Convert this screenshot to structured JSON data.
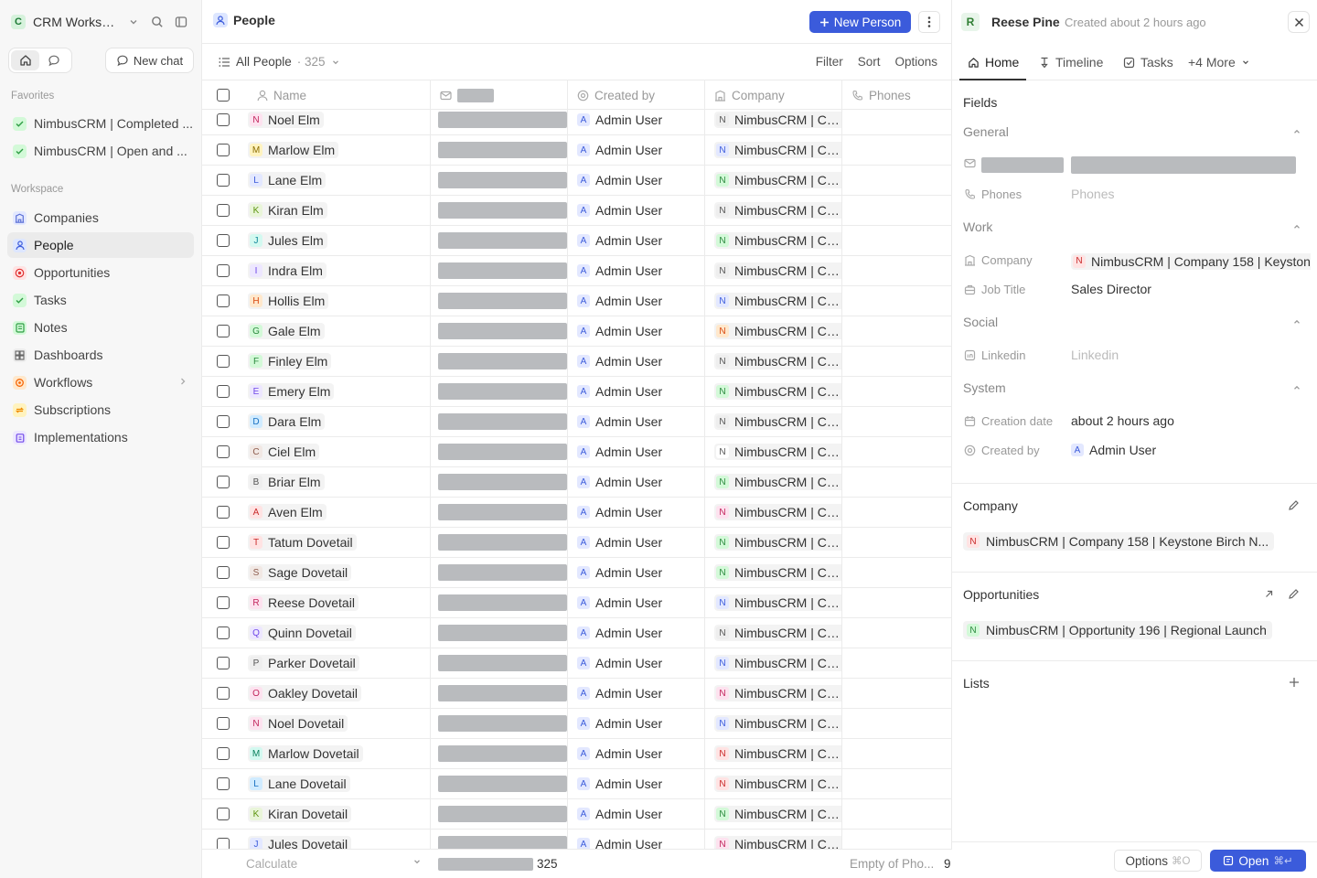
{
  "workspace": {
    "name": "CRM Workspace",
    "logo_letter": "C"
  },
  "sidebar": {
    "new_chat_label": "New chat",
    "favorites_label": "Favorites",
    "favorites": [
      {
        "label": "NimbusCRM | Completed ..."
      },
      {
        "label": "NimbusCRM | Open and ..."
      }
    ],
    "workspace_label": "Workspace",
    "items": [
      {
        "label": "Companies",
        "icon": "building-icon",
        "color": "#5a6fd6",
        "bg": "#e3e8ff"
      },
      {
        "label": "People",
        "icon": "user-icon",
        "color": "#3b5bdb",
        "bg": "#dde6ff"
      },
      {
        "label": "Opportunities",
        "icon": "target-icon",
        "color": "#e03131",
        "bg": "#ffe3e3"
      },
      {
        "label": "Tasks",
        "icon": "checkbox-icon",
        "color": "#2f9e44",
        "bg": "#d3f9d8"
      },
      {
        "label": "Notes",
        "icon": "note-icon",
        "color": "#2f9e44",
        "bg": "#d3f9d8"
      },
      {
        "label": "Dashboards",
        "icon": "dashboard-icon",
        "color": "#666666",
        "bg": "#ececec"
      },
      {
        "label": "Workflows",
        "icon": "workflow-icon",
        "color": "#f76707",
        "bg": "#ffe8cc"
      },
      {
        "label": "Subscriptions",
        "icon": "repeat-icon",
        "color": "#f08c00",
        "bg": "#fff3bf"
      },
      {
        "label": "Implementations",
        "icon": "clipboard-icon",
        "color": "#7048e8",
        "bg": "#ede7ff"
      }
    ]
  },
  "header": {
    "title": "People",
    "new_button": "New Person"
  },
  "view": {
    "name": "All People",
    "count": "· 325",
    "actions": [
      "Filter",
      "Sort",
      "Options"
    ]
  },
  "table": {
    "columns": {
      "name": "Name",
      "created_by": "Created by",
      "company": "Company",
      "phones": "Phones"
    },
    "rows": [
      {
        "letter": "N",
        "name": "Noel Elm",
        "created_by": "Admin User",
        "company": "NimbusCRM | Co...",
        "av": "#fde2ef",
        "avc": "#c2255c",
        "cc": "#eee",
        "ct": "#555"
      },
      {
        "letter": "M",
        "name": "Marlow Elm",
        "created_by": "Admin User",
        "company": "NimbusCRM | Co...",
        "av": "#fff3bf",
        "avc": "#8a6d00",
        "cc": "#e3e8ff",
        "ct": "#3b5bdb"
      },
      {
        "letter": "L",
        "name": "Lane Elm",
        "created_by": "Admin User",
        "company": "NimbusCRM | Co...",
        "av": "#e3e8ff",
        "avc": "#3b5bdb",
        "cc": "#d3f9d8",
        "ct": "#2b8a3e"
      },
      {
        "letter": "K",
        "name": "Kiran Elm",
        "created_by": "Admin User",
        "company": "NimbusCRM | Co...",
        "av": "#e9f5d9",
        "avc": "#5c940d",
        "cc": "#eee",
        "ct": "#555"
      },
      {
        "letter": "J",
        "name": "Jules Elm",
        "created_by": "Admin User",
        "company": "NimbusCRM | Co...",
        "av": "#d3f9f0",
        "avc": "#0c8599",
        "cc": "#d3f9d8",
        "ct": "#2b8a3e"
      },
      {
        "letter": "I",
        "name": "Indra Elm",
        "created_by": "Admin User",
        "company": "NimbusCRM | Co...",
        "av": "#ede7ff",
        "avc": "#7048e8",
        "cc": "#eee",
        "ct": "#555"
      },
      {
        "letter": "H",
        "name": "Hollis Elm",
        "created_by": "Admin User",
        "company": "NimbusCRM | Co...",
        "av": "#ffe8cc",
        "avc": "#d9480f",
        "cc": "#e3e8ff",
        "ct": "#3b5bdb"
      },
      {
        "letter": "G",
        "name": "Gale Elm",
        "created_by": "Admin User",
        "company": "NimbusCRM | Co...",
        "av": "#d3f9d8",
        "avc": "#2b8a3e",
        "cc": "#ffe8cc",
        "ct": "#d9480f"
      },
      {
        "letter": "F",
        "name": "Finley Elm",
        "created_by": "Admin User",
        "company": "NimbusCRM | Co...",
        "av": "#d3f9d8",
        "avc": "#2b8a3e",
        "cc": "#eee",
        "ct": "#555"
      },
      {
        "letter": "E",
        "name": "Emery Elm",
        "created_by": "Admin User",
        "company": "NimbusCRM | Co...",
        "av": "#ede7ff",
        "avc": "#7048e8",
        "cc": "#d3f9d8",
        "ct": "#2b8a3e"
      },
      {
        "letter": "D",
        "name": "Dara Elm",
        "created_by": "Admin User",
        "company": "NimbusCRM | Co...",
        "av": "#d0ebff",
        "avc": "#1971c2",
        "cc": "#eee",
        "ct": "#555"
      },
      {
        "letter": "C",
        "name": "Ciel Elm",
        "created_by": "Admin User",
        "company": "NimbusCRM | Co...",
        "av": "#f1e8e4",
        "avc": "#8d5b4c",
        "cc": "#fff",
        "ct": "#555"
      },
      {
        "letter": "B",
        "name": "Briar Elm",
        "created_by": "Admin User",
        "company": "NimbusCRM | Co...",
        "av": "#eee",
        "avc": "#555",
        "cc": "#d3f9d8",
        "ct": "#2b8a3e"
      },
      {
        "letter": "A",
        "name": "Aven Elm",
        "created_by": "Admin User",
        "company": "NimbusCRM | Co...",
        "av": "#ffe3e3",
        "avc": "#c92a2a",
        "cc": "#fde2ef",
        "ct": "#c2255c"
      },
      {
        "letter": "T",
        "name": "Tatum Dovetail",
        "created_by": "Admin User",
        "company": "NimbusCRM | Co...",
        "av": "#ffe3e3",
        "avc": "#c92a2a",
        "cc": "#d3f9d8",
        "ct": "#2b8a3e"
      },
      {
        "letter": "S",
        "name": "Sage Dovetail",
        "created_by": "Admin User",
        "company": "NimbusCRM | Co...",
        "av": "#f1e8e4",
        "avc": "#8d5b4c",
        "cc": "#d3f9d8",
        "ct": "#2b8a3e"
      },
      {
        "letter": "R",
        "name": "Reese Dovetail",
        "created_by": "Admin User",
        "company": "NimbusCRM | Co...",
        "av": "#fde2ef",
        "avc": "#c2255c",
        "cc": "#e3e8ff",
        "ct": "#3b5bdb"
      },
      {
        "letter": "Q",
        "name": "Quinn Dovetail",
        "created_by": "Admin User",
        "company": "NimbusCRM | Co...",
        "av": "#ede7ff",
        "avc": "#7048e8",
        "cc": "#eee",
        "ct": "#555"
      },
      {
        "letter": "P",
        "name": "Parker Dovetail",
        "created_by": "Admin User",
        "company": "NimbusCRM | Co...",
        "av": "#eee",
        "avc": "#555",
        "cc": "#e3e8ff",
        "ct": "#3b5bdb"
      },
      {
        "letter": "O",
        "name": "Oakley Dovetail",
        "created_by": "Admin User",
        "company": "NimbusCRM | Co...",
        "av": "#fde2ef",
        "avc": "#c2255c",
        "cc": "#fde2ef",
        "ct": "#c2255c"
      },
      {
        "letter": "N",
        "name": "Noel Dovetail",
        "created_by": "Admin User",
        "company": "NimbusCRM | Co...",
        "av": "#fde2ef",
        "avc": "#c2255c",
        "cc": "#e3e8ff",
        "ct": "#3b5bdb"
      },
      {
        "letter": "M",
        "name": "Marlow Dovetail",
        "created_by": "Admin User",
        "company": "NimbusCRM | Co...",
        "av": "#d3f9f0",
        "avc": "#087f5b",
        "cc": "#ffe3e3",
        "ct": "#c92a2a"
      },
      {
        "letter": "L",
        "name": "Lane Dovetail",
        "created_by": "Admin User",
        "company": "NimbusCRM | Co...",
        "av": "#d0ebff",
        "avc": "#1971c2",
        "cc": "#ffe3e3",
        "ct": "#c92a2a"
      },
      {
        "letter": "K",
        "name": "Kiran Dovetail",
        "created_by": "Admin User",
        "company": "NimbusCRM | Co...",
        "av": "#e9f5d9",
        "avc": "#5c940d",
        "cc": "#d3f9d8",
        "ct": "#2b8a3e"
      },
      {
        "letter": "J",
        "name": "Jules Dovetail",
        "created_by": "Admin User",
        "company": "NimbusCRM | Co...",
        "av": "#e3e8ff",
        "avc": "#3b5bdb",
        "cc": "#fde2ef",
        "ct": "#c2255c"
      }
    ],
    "avatar_letter_admin": "A"
  },
  "footer": {
    "calculate": "Calculate",
    "count": "325",
    "empty_phones": "Empty of Pho...",
    "empty_phones_value": "9"
  },
  "panel": {
    "avatar_letter": "R",
    "name": "Reese Pine",
    "created": "Created about 2 hours ago",
    "tabs": [
      "Home",
      "Timeline",
      "Tasks",
      "+4 More"
    ],
    "fields_title": "Fields",
    "groups": {
      "general": "General",
      "work": "Work",
      "social": "Social",
      "system": "System"
    },
    "phones_label": "Phones",
    "phones_placeholder": "Phones",
    "company_label": "Company",
    "company_value": "NimbusCRM | Company 158 | Keystone Birch N...",
    "company_letter": "N",
    "job_title_label": "Job Title",
    "job_title_value": "Sales Director",
    "linkedin_label": "Linkedin",
    "linkedin_placeholder": "Linkedin",
    "creation_date_label": "Creation date",
    "creation_date_value": "about 2 hours ago",
    "created_by_label": "Created by",
    "created_by_value": "Admin User",
    "created_by_letter": "A",
    "company_section": "Company",
    "company_chip": "NimbusCRM | Company 158 | Keystone Birch N...",
    "opportunities_section": "Opportunities",
    "opportunity_chip": "NimbusCRM | Opportunity 196 | Regional Launch",
    "lists_section": "Lists",
    "options_button": "Options",
    "options_shortcut": "⌘O",
    "open_button": "Open",
    "open_shortcut": "⌘↵"
  }
}
